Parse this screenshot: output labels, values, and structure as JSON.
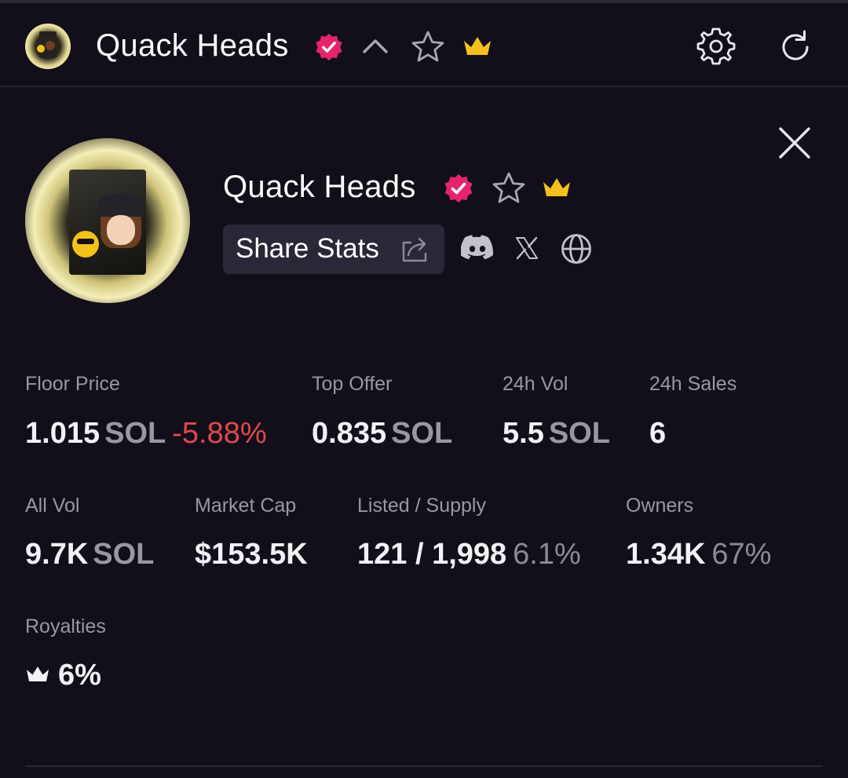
{
  "header": {
    "title": "Quack Heads",
    "icons": [
      "verified-badge-icon",
      "chevron-up-icon",
      "star-icon",
      "crown-icon",
      "gear-icon",
      "refresh-icon"
    ]
  },
  "collection": {
    "name": "Quack Heads",
    "share_label": "Share Stats",
    "social_icons": [
      "discord-icon",
      "x-icon",
      "globe-icon"
    ]
  },
  "stats": {
    "floor_price": {
      "label": "Floor Price",
      "value": "1.015",
      "unit": "SOL",
      "change": "-5.88%"
    },
    "top_offer": {
      "label": "Top Offer",
      "value": "0.835",
      "unit": "SOL"
    },
    "vol_24h": {
      "label": "24h Vol",
      "value": "5.5",
      "unit": "SOL"
    },
    "sales_24h": {
      "label": "24h Sales",
      "value": "6"
    },
    "all_vol": {
      "label": "All Vol",
      "value": "9.7K",
      "unit": "SOL"
    },
    "market_cap": {
      "label": "Market Cap",
      "value": "$153.5K"
    },
    "listed_supply": {
      "label": "Listed / Supply",
      "value": "121 / 1,998",
      "pct": "6.1%"
    },
    "owners": {
      "label": "Owners",
      "value": "1.34K",
      "pct": "67%"
    },
    "royalties": {
      "label": "Royalties",
      "value": "6%"
    }
  },
  "colors": {
    "background": "#120f1a",
    "verified": "#e6246e",
    "crown": "#f4c01e",
    "negative": "#e0484d",
    "button_bg": "#2a2738"
  }
}
